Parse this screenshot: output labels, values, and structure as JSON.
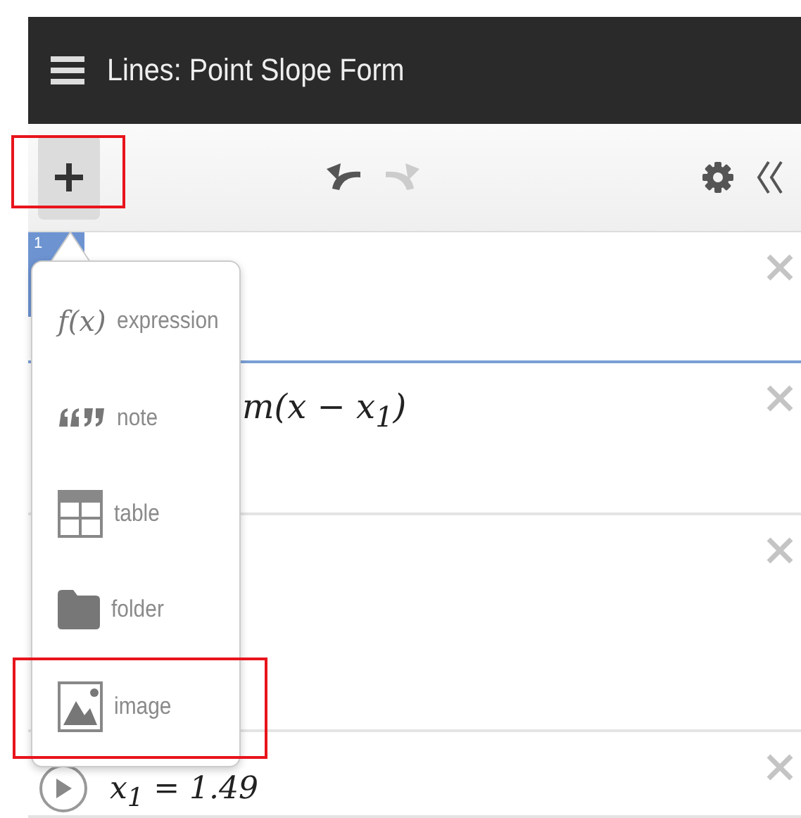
{
  "header": {
    "title": "Lines: Point Slope Form"
  },
  "toolbar": {
    "add_highlighted": true,
    "undo_disabled": false,
    "redo_disabled": true
  },
  "expressions": [
    {
      "kind": "empty",
      "number": "1",
      "selected": true
    },
    {
      "kind": "math",
      "text": "m(x − x$_{1}$)",
      "selected": false
    },
    {
      "kind": "empty",
      "selected": false
    },
    {
      "kind": "slider",
      "text": "x$_{1}$ = 1.49",
      "selected": false
    }
  ],
  "add_menu": {
    "items": [
      {
        "kind": "expression",
        "glyph": "f(x)",
        "label": "expression",
        "highlighted": false
      },
      {
        "kind": "note",
        "label": "note",
        "highlighted": false
      },
      {
        "kind": "table",
        "label": "table",
        "highlighted": false
      },
      {
        "kind": "folder",
        "label": "folder",
        "highlighted": false
      },
      {
        "kind": "image",
        "label": "image",
        "highlighted": true
      }
    ]
  }
}
